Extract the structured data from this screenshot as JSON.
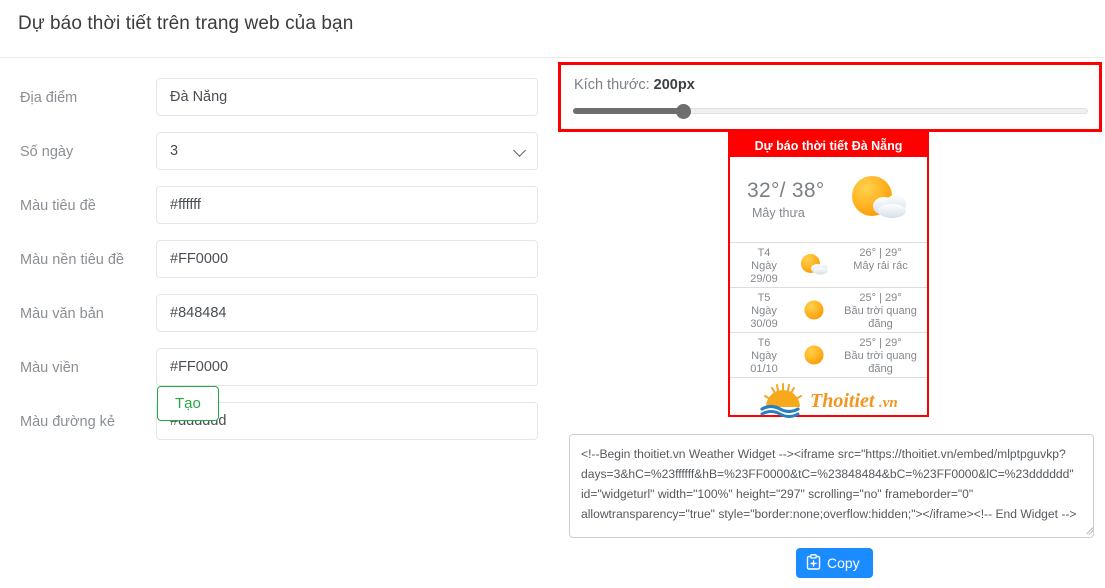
{
  "header": {
    "title": "Dự báo thời tiết trên trang web của bạn"
  },
  "form": {
    "fields": [
      {
        "label": "Địa điểm",
        "value": "Đà Nẵng",
        "type": "text",
        "name": "location"
      },
      {
        "label": "Số ngày",
        "value": "3",
        "type": "select",
        "name": "days",
        "options": [
          "3"
        ]
      },
      {
        "label": "Màu tiêu đề",
        "value": "#ffffff",
        "type": "text",
        "name": "title-color"
      },
      {
        "label": "Màu nền tiêu đề",
        "value": "#FF0000",
        "type": "text",
        "name": "title-bg-color"
      },
      {
        "label": "Màu văn bản",
        "value": "#848484",
        "type": "text",
        "name": "text-color"
      },
      {
        "label": "Màu viền",
        "value": "#FF0000",
        "type": "text",
        "name": "border-color"
      },
      {
        "label": "Màu đường kẻ",
        "value": "#dddddd",
        "type": "text",
        "name": "line-color"
      }
    ],
    "create_button": "Tạo"
  },
  "size_panel": {
    "label_prefix": "Kích thước: ",
    "value": "200px",
    "slider": {
      "percent": 20,
      "min": 0,
      "max": 1000,
      "current": 200
    },
    "border_color": "#FF0000"
  },
  "widget": {
    "title": "Dự báo thời tiết Đà Nẵng",
    "header_bg": "#FF0000",
    "header_color": "#ffffff",
    "border_color": "#FF0000",
    "line_color": "#dddddd",
    "text_color": "#848484",
    "current": {
      "temp": "32°/ 38°",
      "desc": "Mây thưa",
      "icon": "sun-cloud-icon"
    },
    "forecast": [
      {
        "weekday": "T4",
        "date_prefix": "Ngày",
        "date": "29/09",
        "temps": "26° | 29°",
        "desc": "Mây rải rác",
        "icon": "sun-cloud-icon"
      },
      {
        "weekday": "T5",
        "date_prefix": "Ngày",
        "date": "30/09",
        "temps": "25° | 29°",
        "desc": "Bầu trời quang đãng",
        "icon": "sun-icon"
      },
      {
        "weekday": "T6",
        "date_prefix": "Ngày",
        "date": "01/10",
        "temps": "25° | 29°",
        "desc": "Bầu trời quang đãng",
        "icon": "sun-icon"
      }
    ],
    "logo_text": "Thoitiet",
    "logo_suffix": ".vn"
  },
  "embed": {
    "code": "<!--Begin thoitiet.vn Weather Widget --><iframe src=\"https://thoitiet.vn/embed/mlptpguvkp?days=3&hC=%23ffffff&hB=%23FF0000&tC=%23848484&bC=%23FF0000&lC=%23dddddd\" id=\"widgeturl\" width=\"100%\" height=\"297\" scrolling=\"no\" frameborder=\"0\" allowtransparency=\"true\" style=\"border:none;overflow:hidden;\"></iframe><!-- End Widget -->",
    "copy_button": "Copy",
    "copy_button_color": "#1a8cff"
  }
}
